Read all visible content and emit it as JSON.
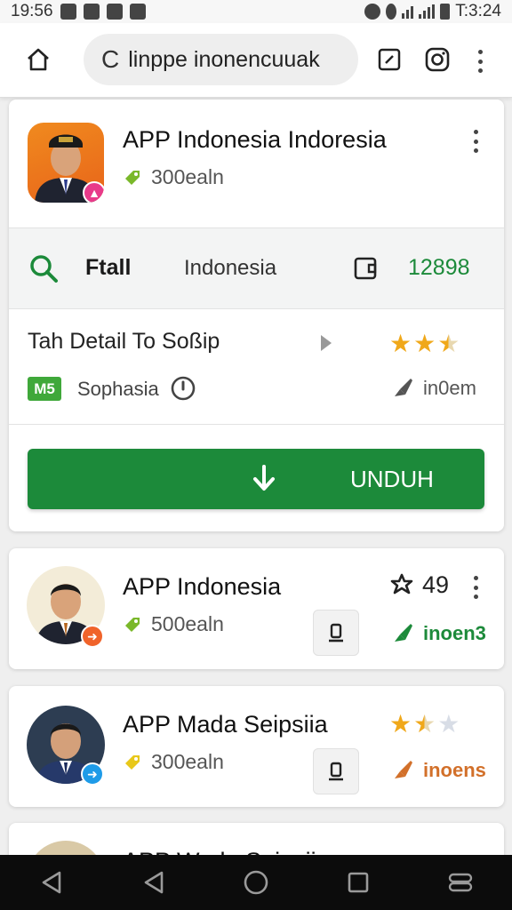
{
  "status_bar": {
    "time": "19:56",
    "right_text": "T:3:24"
  },
  "browser": {
    "url": "linppe inonencuuak"
  },
  "featured_app": {
    "title": "APP Indonesia Indoresia",
    "size": "300ealn",
    "info_label": "Ftall",
    "info_region": "Indonesia",
    "info_count": "12898",
    "detail_text": "Tah Detail To Soßip",
    "dev_badge": "M5",
    "developer": "Sophasia",
    "tag": "in0em",
    "rating": 2.5,
    "download_label": "UNDUH"
  },
  "apps": [
    {
      "title": "APP Indonesia",
      "size": "500ealn",
      "score": "49",
      "tag": "inoen3",
      "badge_color": "#f0632a",
      "tag_color": "#1c8a3a"
    },
    {
      "title": "APP Mada Seipsiia",
      "size": "300ealn",
      "tag": "inoens",
      "rating": 1.5,
      "badge_color": "#1e9be8",
      "tag_color": "#d2702a"
    },
    {
      "title": "APP Wada Seipsiia"
    }
  ],
  "colors": {
    "accent_green": "#1c8a3a",
    "star": "#f0a81a"
  },
  "icons": [
    "home-icon",
    "reload-icon",
    "tabs-icon",
    "instagram-icon",
    "more-icon",
    "search-icon",
    "wallet-icon",
    "play-icon",
    "clock-icon",
    "download-icon",
    "back-icon",
    "home-circle-icon",
    "recents-icon"
  ]
}
